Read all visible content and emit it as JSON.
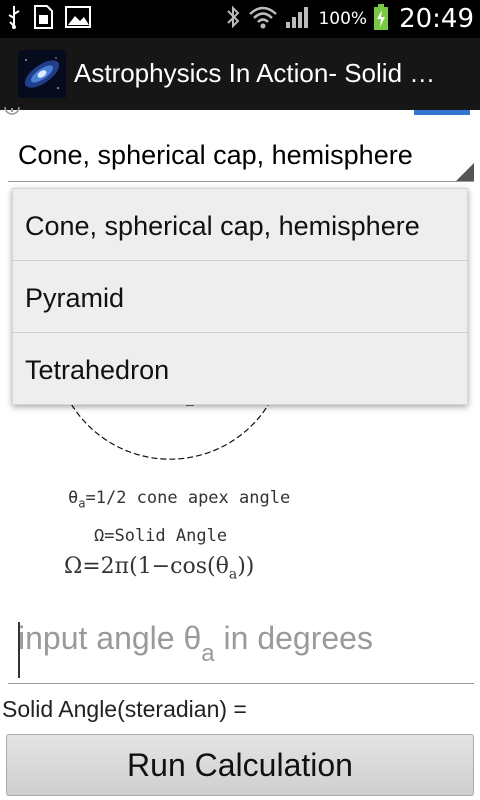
{
  "status_bar": {
    "battery_percent": "100%",
    "time": "20:49",
    "icons": [
      "usb-icon",
      "sim-card-icon",
      "image-icon",
      "bluetooth-icon",
      "wifi-icon",
      "signal-icon",
      "battery-charging-icon"
    ]
  },
  "action_bar": {
    "title": "Astrophysics In Action- Solid …"
  },
  "spinner": {
    "selected": "Cone, spherical cap, hemisphere"
  },
  "dropdown": {
    "options": [
      {
        "label": "Cone, spherical cap, hemisphere"
      },
      {
        "label": "Pyramid"
      },
      {
        "label": "Tetrahedron"
      }
    ]
  },
  "diagram": {
    "line1_symbol": "θ",
    "line1_sub": "a",
    "line1_text": "=1/2 cone apex angle",
    "line2": "Ω=Solid Angle",
    "formula_prefix": "Ω=2π(1−cos(θ",
    "formula_sub": "a",
    "formula_suffix": "))"
  },
  "input": {
    "placeholder_main": "input angle θ",
    "placeholder_sub": "a",
    "placeholder_tail": " in degrees"
  },
  "result": {
    "label": "Solid Angle(steradian) ="
  },
  "run_button": {
    "label": "Run Calculation"
  },
  "colors": {
    "status_bar_bg": "#000000",
    "action_bar_bg": "#161616",
    "accent": "#2f77d1",
    "battery": "#7ac943"
  }
}
